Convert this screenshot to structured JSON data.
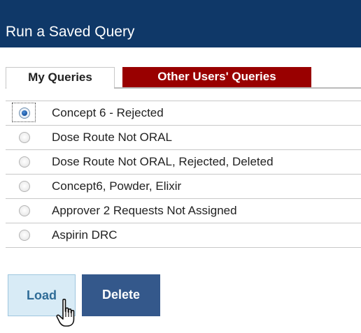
{
  "header": {
    "title": "Run a Saved Query"
  },
  "tabs": [
    {
      "label": "My Queries",
      "active": true
    },
    {
      "label": "Other Users' Queries",
      "active": false
    }
  ],
  "queries": [
    {
      "label": "Concept 6 - Rejected",
      "selected": true
    },
    {
      "label": "Dose Route Not ORAL",
      "selected": false
    },
    {
      "label": "Dose Route Not ORAL, Rejected, Deleted",
      "selected": false
    },
    {
      "label": "Concept6, Powder, Elixir",
      "selected": false
    },
    {
      "label": "Approver 2 Requests Not Assigned",
      "selected": false
    },
    {
      "label": "Aspirin DRC",
      "selected": false
    }
  ],
  "buttons": {
    "load_label": "Load",
    "delete_label": "Delete"
  },
  "icons": {
    "cursor": "hand-pointer-icon"
  },
  "colors": {
    "header_bg": "#0f3868",
    "tab_inactive_bg": "#990000",
    "load_bg": "#d8ebf6",
    "delete_bg": "#34588b"
  }
}
